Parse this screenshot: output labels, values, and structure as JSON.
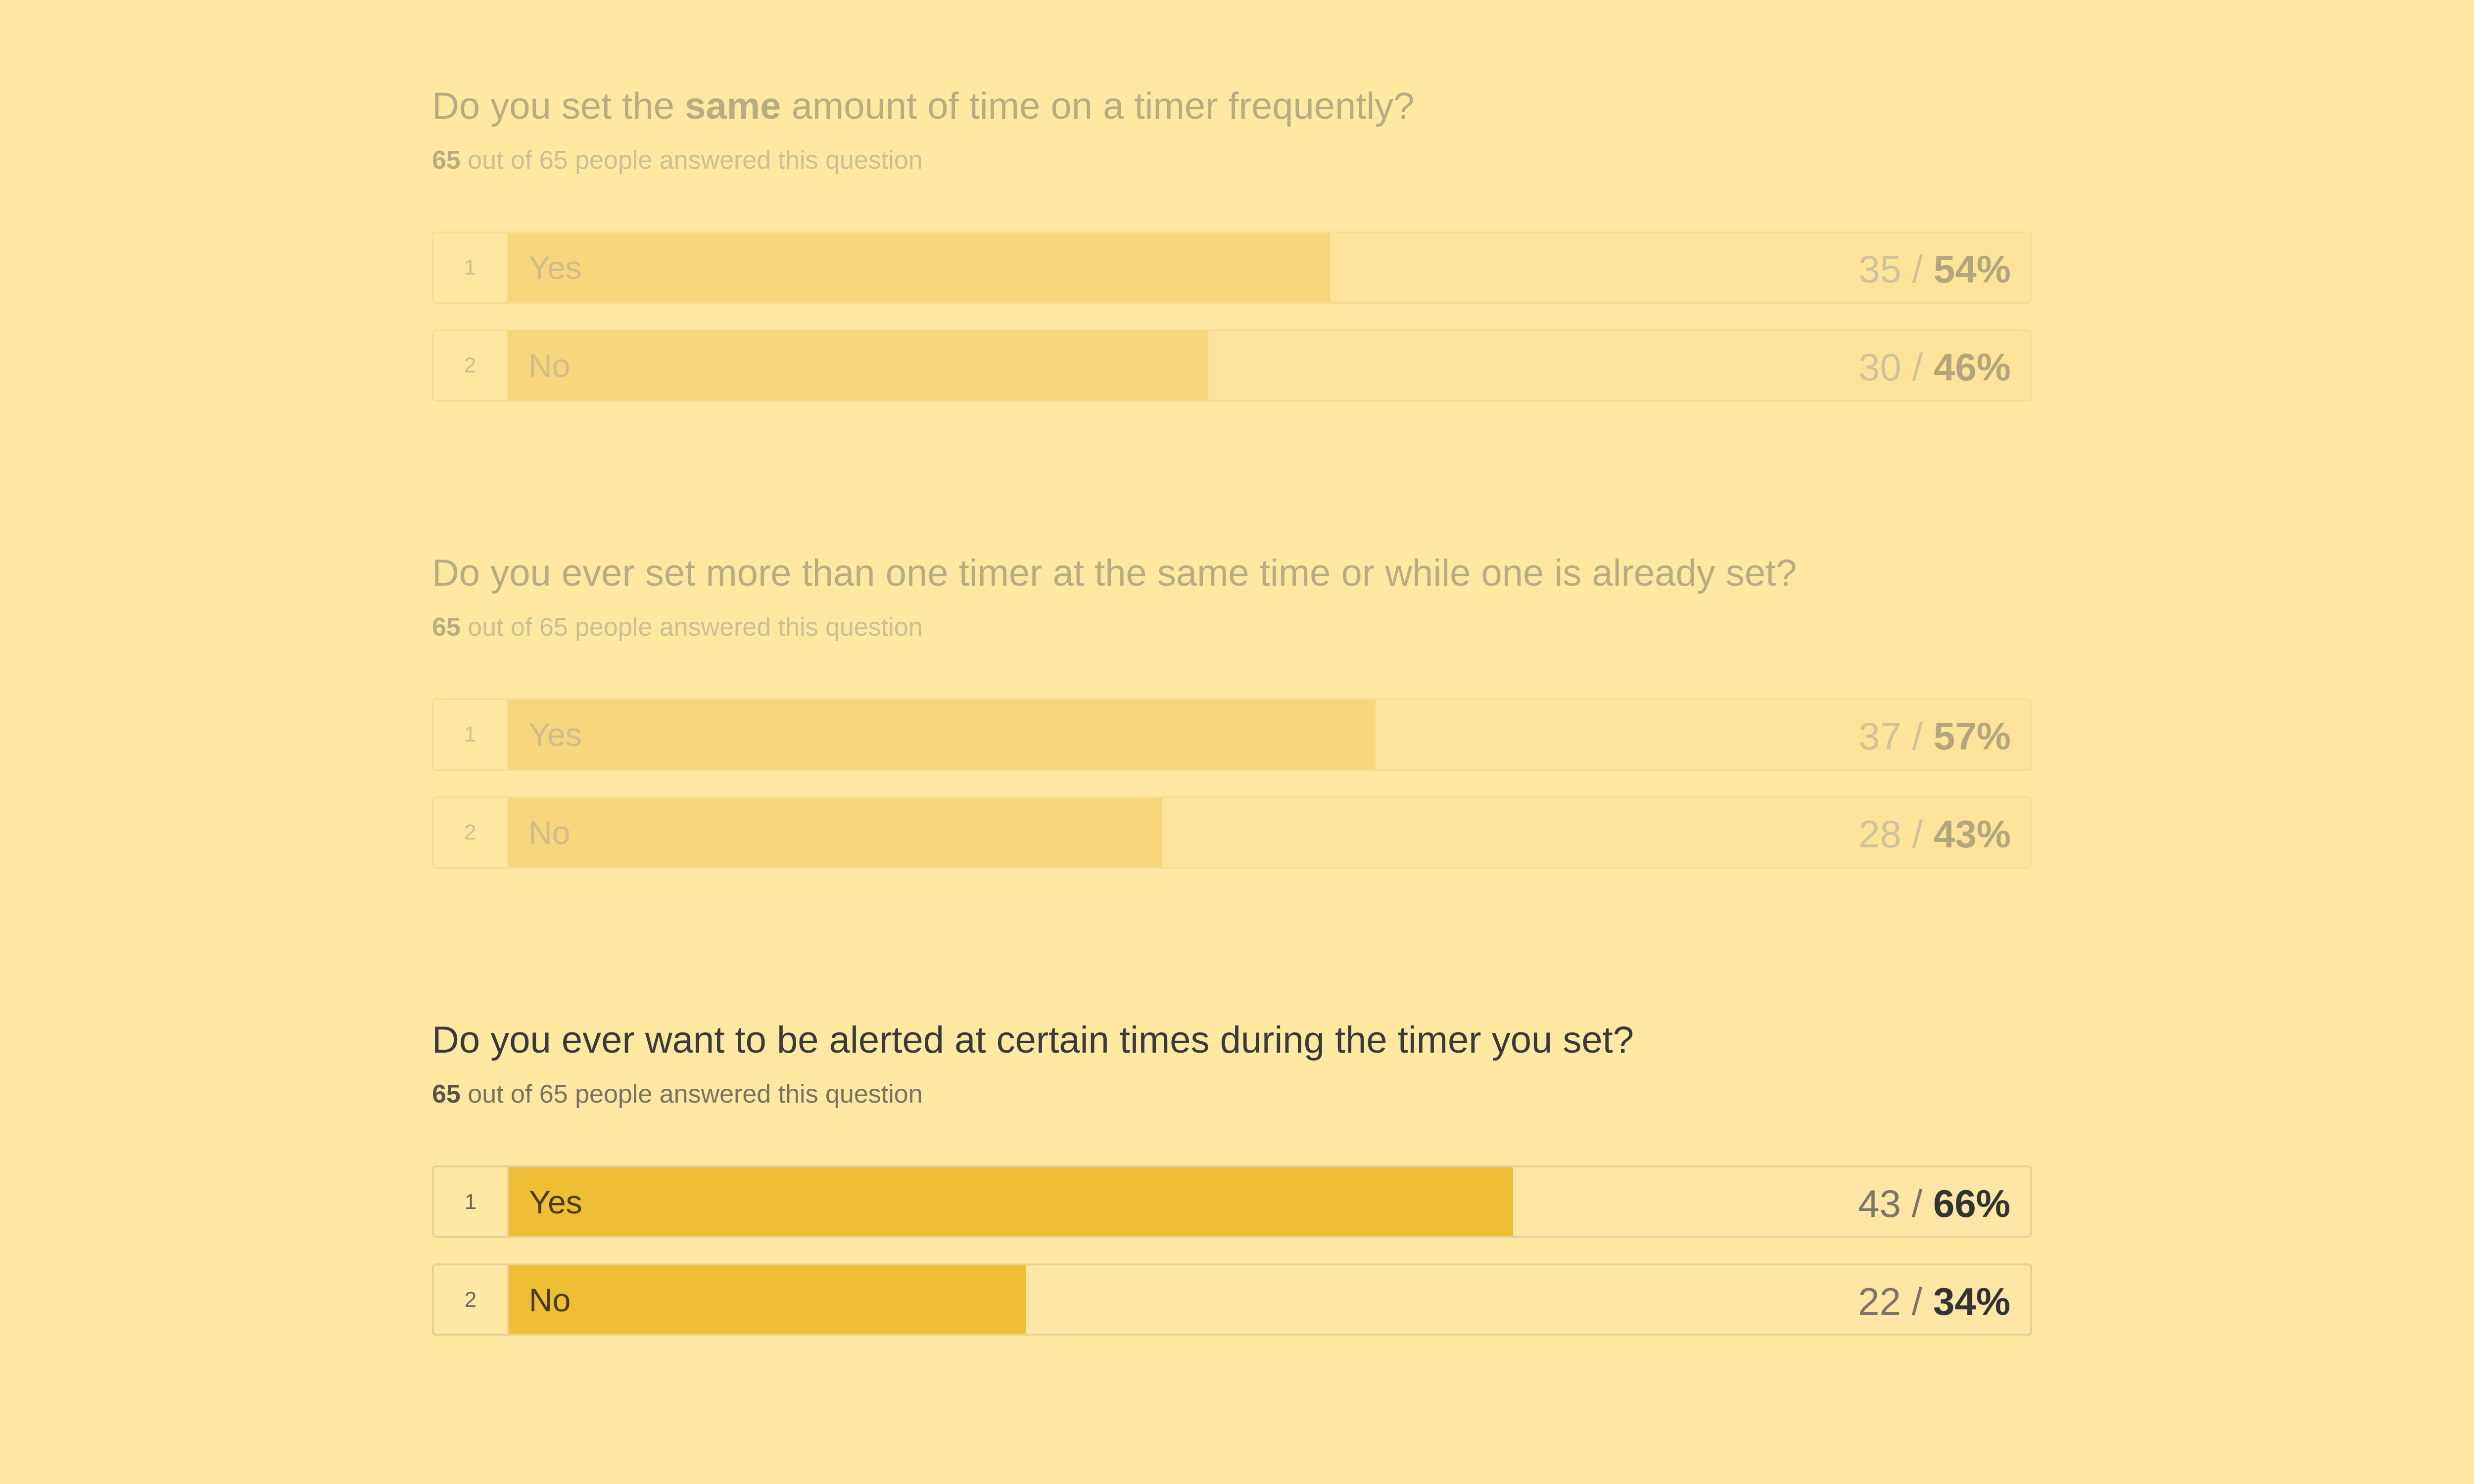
{
  "questions": [
    {
      "title_before": "Do you set the ",
      "title_emphasis": "same",
      "title_after": " amount of time on a timer frequently?",
      "respondents": {
        "answered_count": "65",
        "rest_text": " out of 65 people answered this question"
      },
      "answers": [
        {
          "index": "1",
          "label": "Yes",
          "count": "35",
          "separator": " / ",
          "percent_text": "54%",
          "percent": 54
        },
        {
          "index": "2",
          "label": "No",
          "count": "30",
          "separator": " / ",
          "percent_text": "46%",
          "percent": 46
        }
      ]
    },
    {
      "title_before": "Do you ever set more than one timer at the same time or while one is already set?",
      "title_emphasis": "",
      "title_after": "",
      "respondents": {
        "answered_count": "65",
        "rest_text": " out of 65 people answered this question"
      },
      "answers": [
        {
          "index": "1",
          "label": "Yes",
          "count": "37",
          "separator": " / ",
          "percent_text": "57%",
          "percent": 57
        },
        {
          "index": "2",
          "label": "No",
          "count": "28",
          "separator": " / ",
          "percent_text": "43%",
          "percent": 43
        }
      ]
    },
    {
      "title_before": "Do you ever want to be alerted at certain times during the timer you set?",
      "title_emphasis": "",
      "title_after": "",
      "respondents": {
        "answered_count": "65",
        "rest_text": " out of 65 people answered this question"
      },
      "answers": [
        {
          "index": "1",
          "label": "Yes",
          "count": "43",
          "separator": " / ",
          "percent_text": "66%",
          "percent": 66
        },
        {
          "index": "2",
          "label": "No",
          "count": "22",
          "separator": " / ",
          "percent_text": "34%",
          "percent": 34
        }
      ]
    }
  ],
  "colors": {
    "page_background": "#fee8a2",
    "active_bar": "#eebe34",
    "dimmed_bar": "#f7d77d"
  }
}
